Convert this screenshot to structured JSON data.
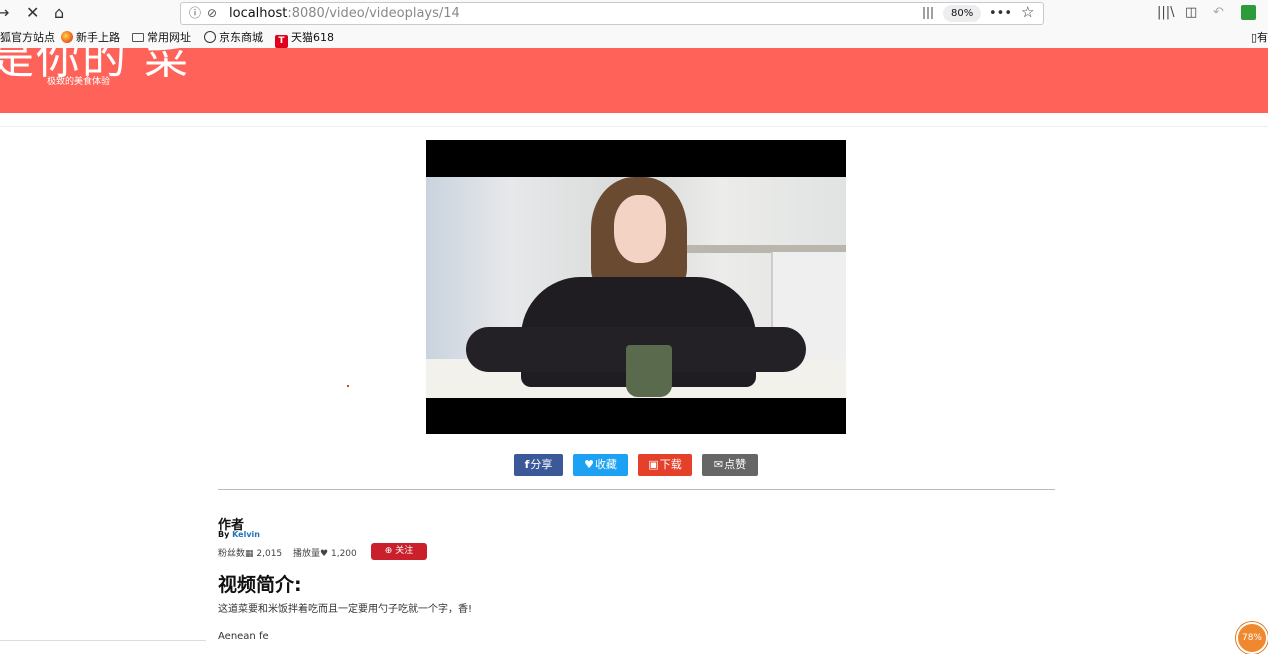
{
  "browser": {
    "back_icon": "→",
    "stop_icon": "✕",
    "home_icon": "⌂",
    "url_host": "localhost",
    "url_rest": ":8080/video/videoplays/14",
    "zoom": "80%",
    "more_icon": "•••",
    "bookmark_star_icon": "☆"
  },
  "bookmarks": {
    "items": [
      "狐官方站点",
      "新手上路",
      "常用网址",
      "京东商城",
      "天猫618"
    ],
    "tmall_logo": "T",
    "right_item": "▯有"
  },
  "header": {
    "brand": "是你的 菜",
    "tagline": "极致的美食体验",
    "color": "#fe6258"
  },
  "actions": {
    "share": "分享",
    "share_icon": "f",
    "favorite": "收藏",
    "favorite_icon": "♥",
    "download": "下载",
    "download_icon": "▣",
    "like": "点赞",
    "like_icon": "✉"
  },
  "author": {
    "heading": "作者",
    "by_prefix": "By ",
    "name": "Kelvin",
    "fans_label": "粉丝数",
    "fans_count": "2,015",
    "plays_label": "播放量",
    "plays_count": "1,200",
    "follow_label": "关注"
  },
  "intro": {
    "heading": "视频简介:",
    "text": "这道菜要和米饭拌着吃而且一定要用勺子吃就一个字，香!",
    "extra": "Aenean fe"
  },
  "perf_badge": "78%"
}
